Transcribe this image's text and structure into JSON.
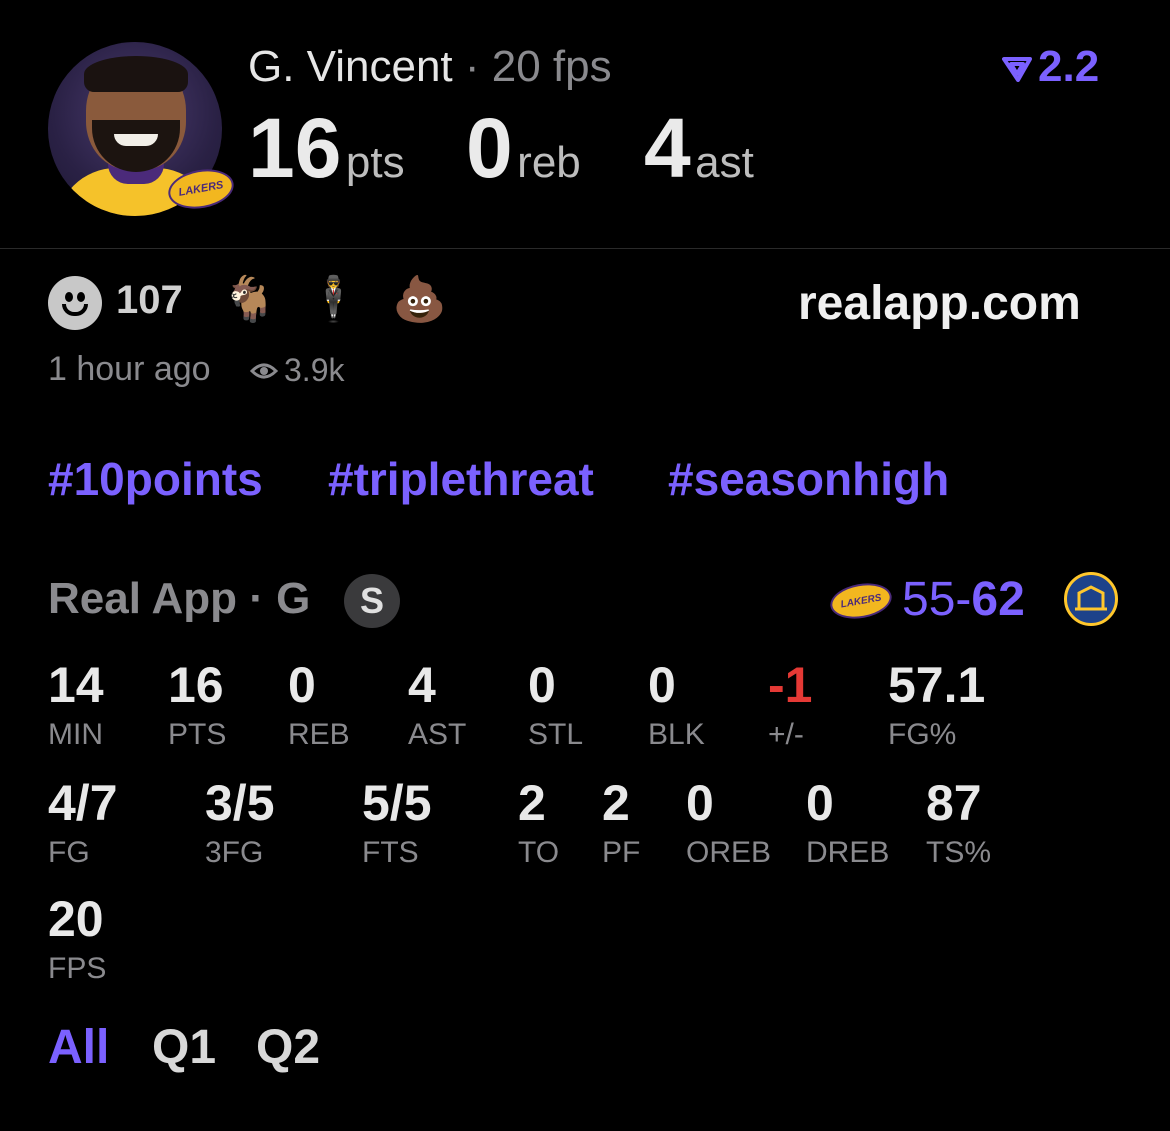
{
  "header": {
    "player_name": "G. Vincent",
    "separator": "·",
    "fps_text": "20 fps",
    "pts_value": "16",
    "pts_unit": "pts",
    "reb_value": "0",
    "reb_unit": "reb",
    "ast_value": "4",
    "ast_unit": "ast",
    "version": "2.2",
    "logo_text": "LAKERS"
  },
  "reactions": {
    "count": "107",
    "goat_emoji": "🐐",
    "person_emoji": "🕴",
    "poop_emoji": "💩",
    "site": "realapp.com"
  },
  "meta": {
    "time_ago": "1 hour ago",
    "views": "3.9k"
  },
  "tags": [
    "#10points",
    "#triplethreat",
    "#seasonhigh"
  ],
  "game": {
    "label": "Real App · G",
    "badge": "S",
    "home_score": "55-",
    "away_score": "62",
    "home_logo_text": "LAKERS"
  },
  "stats_row1": [
    {
      "value": "14",
      "label": "MIN"
    },
    {
      "value": "16",
      "label": "PTS"
    },
    {
      "value": "0",
      "label": "REB"
    },
    {
      "value": "4",
      "label": "AST"
    },
    {
      "value": "0",
      "label": "STL"
    },
    {
      "value": "0",
      "label": "BLK"
    },
    {
      "value": "-1",
      "label": "+/-"
    },
    {
      "value": "57.1",
      "label": "FG%"
    }
  ],
  "stats_row2": [
    {
      "value": "4/7",
      "label": "FG"
    },
    {
      "value": "3/5",
      "label": "3FG"
    },
    {
      "value": "5/5",
      "label": "FTS"
    },
    {
      "value": "2",
      "label": "TO"
    },
    {
      "value": "2",
      "label": "PF"
    },
    {
      "value": "0",
      "label": "OREB"
    },
    {
      "value": "0",
      "label": "DREB"
    },
    {
      "value": "87",
      "label": "TS%"
    }
  ],
  "stats_row3": [
    {
      "value": "20",
      "label": "FPS"
    }
  ],
  "quarter_tabs": [
    "All",
    "Q1",
    "Q2"
  ],
  "colors": {
    "accent": "#7b61ff",
    "negative": "#e53935"
  }
}
